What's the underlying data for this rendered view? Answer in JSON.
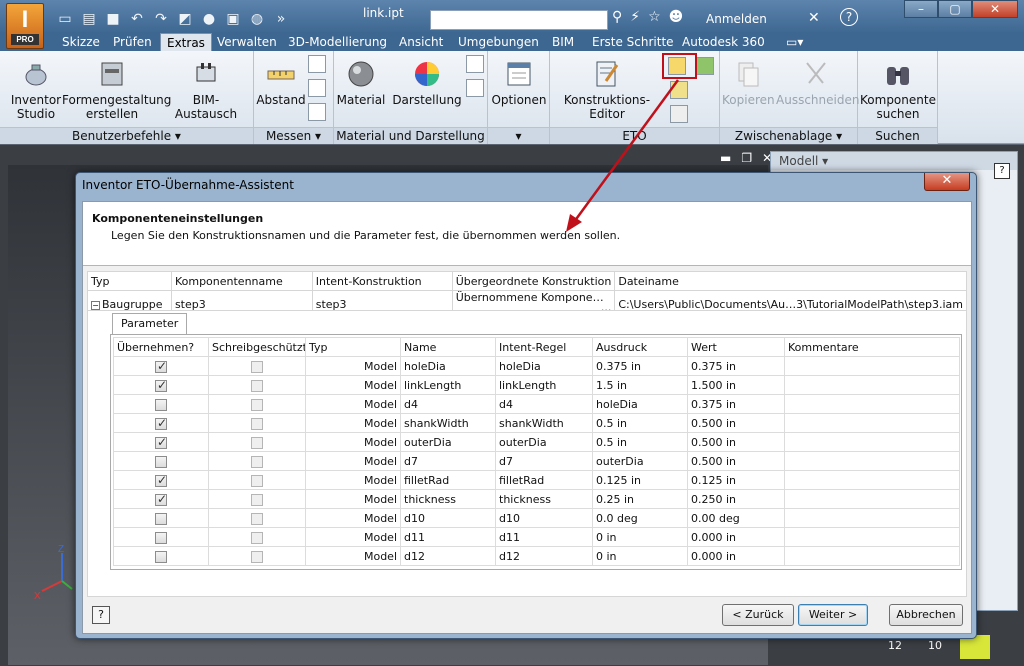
{
  "titlebar": {
    "app_label": "I",
    "app_badge": "PRO",
    "document_title": "link.ipt",
    "search_placeholder": "",
    "signin_label": "Anmelden",
    "help_label": "?"
  },
  "tabs": [
    {
      "label": "Skizze"
    },
    {
      "label": "Prüfen"
    },
    {
      "label": "Extras",
      "active": true
    },
    {
      "label": "Verwalten"
    },
    {
      "label": "3D-Modellierung"
    },
    {
      "label": "Ansicht"
    },
    {
      "label": "Umgebungen"
    },
    {
      "label": "BIM"
    },
    {
      "label": "Erste Schritte"
    },
    {
      "label": "Autodesk 360"
    }
  ],
  "ribbon": {
    "panels": {
      "benutzerbefehle": "Benutzerbefehle ▾",
      "messen": "Messen ▾",
      "material": "Material und Darstellung ▾",
      "optionen": "▾",
      "eto": "ETO",
      "zwischenablage": "Zwischenablage ▾",
      "suchen": "Suchen"
    },
    "buttons": {
      "inventor_studio_1": "Inventor",
      "inventor_studio_2": "Studio",
      "formen_1": "Formengestaltung",
      "formen_2": "erstellen",
      "bim_austausch": "BIM-Austausch",
      "abstand": "Abstand",
      "material": "Material",
      "darstellung": "Darstellung",
      "optionen": "Optionen",
      "konstruktions_editor": "Konstruktions-Editor",
      "kopieren": "Kopieren",
      "ausschneiden": "Ausschneiden",
      "komponente_1": "Komponente",
      "komponente_2": "suchen"
    }
  },
  "workspace": {
    "model_panel_title": "Modell ▾",
    "status_num_1": "12",
    "status_num_2": "10",
    "axis_z": "Z",
    "axis_x": "X"
  },
  "dialog": {
    "title": "Inventor ETO-Übernahme-Assistent",
    "heading": "Komponenteneinstellungen",
    "subheading": "Legen Sie den Konstruktionsnamen und die Parameter fest, die übernommen werden sollen.",
    "component_columns": [
      "Typ",
      "Komponentenname",
      "Intent-Konstruktion",
      "Übergeordnete Konstruktion",
      "Dateiname"
    ],
    "component_row": {
      "typ": "Baugruppe",
      "komponentenname": "step3",
      "intent": "step3",
      "uebergeordnet": "Übernommene Kompone…",
      "ellipsis": "···",
      "dateiname": "C:\\Users\\Public\\Documents\\Au…3\\TutorialModelPath\\step3.iam"
    },
    "param_tab": "Parameter",
    "param_columns": [
      "Übernehmen?",
      "Schreibgeschützt?",
      "Typ",
      "Name",
      "Intent-Regel",
      "Ausdruck",
      "Wert",
      "Kommentare"
    ],
    "parameters": [
      {
        "take": true,
        "ro": false,
        "typ": "Model",
        "name": "holeDia",
        "rule": "holeDia",
        "expr": "0.375 in",
        "wert": "0.375 in"
      },
      {
        "take": true,
        "ro": false,
        "typ": "Model",
        "name": "linkLength",
        "rule": "linkLength",
        "expr": "1.5 in",
        "wert": "1.500 in"
      },
      {
        "take": false,
        "ro": false,
        "typ": "Model",
        "name": "d4",
        "rule": "d4",
        "expr": "holeDia",
        "wert": "0.375 in"
      },
      {
        "take": true,
        "ro": false,
        "typ": "Model",
        "name": "shankWidth",
        "rule": "shankWidth",
        "expr": "0.5 in",
        "wert": "0.500 in"
      },
      {
        "take": true,
        "ro": false,
        "typ": "Model",
        "name": "outerDia",
        "rule": "outerDia",
        "expr": "0.5 in",
        "wert": "0.500 in"
      },
      {
        "take": false,
        "ro": false,
        "typ": "Model",
        "name": "d7",
        "rule": "d7",
        "expr": "outerDia",
        "wert": "0.500 in"
      },
      {
        "take": true,
        "ro": false,
        "typ": "Model",
        "name": "filletRad",
        "rule": "filletRad",
        "expr": "0.125 in",
        "wert": "0.125 in"
      },
      {
        "take": true,
        "ro": false,
        "typ": "Model",
        "name": "thickness",
        "rule": "thickness",
        "expr": "0.25 in",
        "wert": "0.250 in"
      },
      {
        "take": false,
        "ro": false,
        "typ": "Model",
        "name": "d10",
        "rule": "d10",
        "expr": "0.0 deg",
        "wert": "0.00 deg"
      },
      {
        "take": false,
        "ro": false,
        "typ": "Model",
        "name": "d11",
        "rule": "d11",
        "expr": "0 in",
        "wert": "0.000 in"
      },
      {
        "take": false,
        "ro": false,
        "typ": "Model",
        "name": "d12",
        "rule": "d12",
        "expr": "0 in",
        "wert": "0.000 in"
      }
    ],
    "help_label": "?",
    "back_label": "< Zurück",
    "next_label": "Weiter >",
    "cancel_label": "Abbrechen"
  },
  "colors": {
    "titlebar": "#3d6690",
    "highlight": "#c0111b",
    "arrow": "#c0111b"
  }
}
